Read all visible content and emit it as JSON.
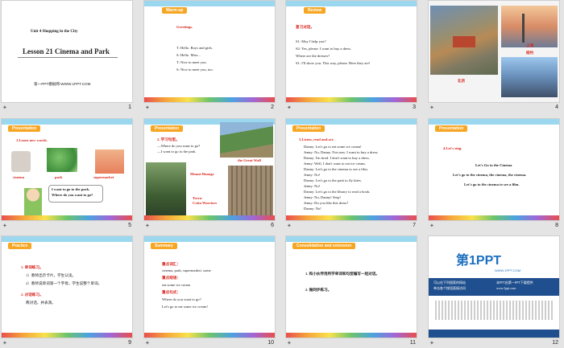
{
  "slides": [
    {
      "num": "1",
      "unit": "Unit 4  Shopping in the City",
      "title": "Lesson 21  Cinema and Park",
      "site": "第一PPT模板网-WWW.1PPT.COM"
    },
    {
      "num": "2",
      "tag": "Warm-up",
      "heading": "Greetings.",
      "lines": [
        "T: Hello. Boys and girls.",
        "S: Hello. Miss...",
        "T: Nice to meet you.",
        "S: Nice to meet you, too."
      ]
    },
    {
      "num": "3",
      "tag": "Review",
      "heading": "复习对话。",
      "lines": [
        "S1: May I help you?",
        "S2: Yes, please. I want to buy a dress.",
        "      Where are the dresses?",
        "S1: I'll show you. This way, please. Here they are!"
      ]
    },
    {
      "num": "4",
      "labels": [
        "上海",
        "纽约",
        "北京"
      ]
    },
    {
      "num": "5",
      "tag": "Presentation",
      "heading": "1.Learn new words.",
      "words": [
        "cinema",
        "park",
        "supermarket"
      ],
      "bubble": [
        "I want to go to the park.",
        "Where do you want to go?"
      ]
    },
    {
      "num": "6",
      "tag": "Presentation",
      "heading": "2. 学习句型。",
      "lines": [
        "—Where do you want to go?",
        "—I want to go to the park."
      ],
      "labels": [
        "the Great Wall",
        "Mount Huangs",
        "Terra-",
        "Cotta Warriors"
      ]
    },
    {
      "num": "7",
      "tag": "Presentation",
      "heading": "3.Listen, read and act.",
      "lines": [
        "Danny: Let's go to eat some ice cream!",
        "Jenny: No, Danny. Not now. I want to buy a dress.",
        "Danny: I'm tired. I don't want to buy a dress.",
        "Jenny: Well, I don't want to eat ice cream.",
        "Danny: Let's go to the cinema to see a film.",
        "Jenny: No!",
        "Danny: Let's go to the park to fly kites.",
        "Jenny: No!",
        "Danny: Let's go to the library to read a book.",
        "Jenny: No, Danny! Stop!",
        "Jenny: Do you like this dress?",
        "Danny: No!"
      ]
    },
    {
      "num": "8",
      "tag": "Presentation",
      "heading": "4.Let's sing.",
      "lines": [
        "Let's Go to the Cinema",
        "Let's go to the cinema, the cinema, the cinema.",
        "Let's go to the cinema to see a film."
      ]
    },
    {
      "num": "9",
      "tag": "Practice",
      "lines": [
        "1.  单词练习。",
        "1）教师出示卡片，学生认读。",
        "2）教师说单词第一个字母，学生说整个单词。",
        "2.  对话练习。",
        "  两对话，并表演。"
      ]
    },
    {
      "num": "10",
      "tag": "Summary",
      "lines": [
        "重点词汇：",
        "cinema, park, supermarket, some",
        "重点短语：",
        "eat some ice cream",
        "重点句式：",
        "Where do you want to go?",
        "Let's go to eat some ice cream!"
      ]
    },
    {
      "num": "11",
      "tag": "Consolidation and extension",
      "lines": [
        "1.  和小伙伴用所学单词和句型编写一组对话。",
        "2.  做同步练习。"
      ]
    },
    {
      "num": "12",
      "logo": "第1PPT",
      "logo_sub": "WWW.1PPT.COM",
      "promo": [
        "可以在下列搜索的网站",
        "单击各个按钮直接访问",
        "本PPT由第一PPT下载提供",
        "www.1ppt.com"
      ]
    }
  ]
}
